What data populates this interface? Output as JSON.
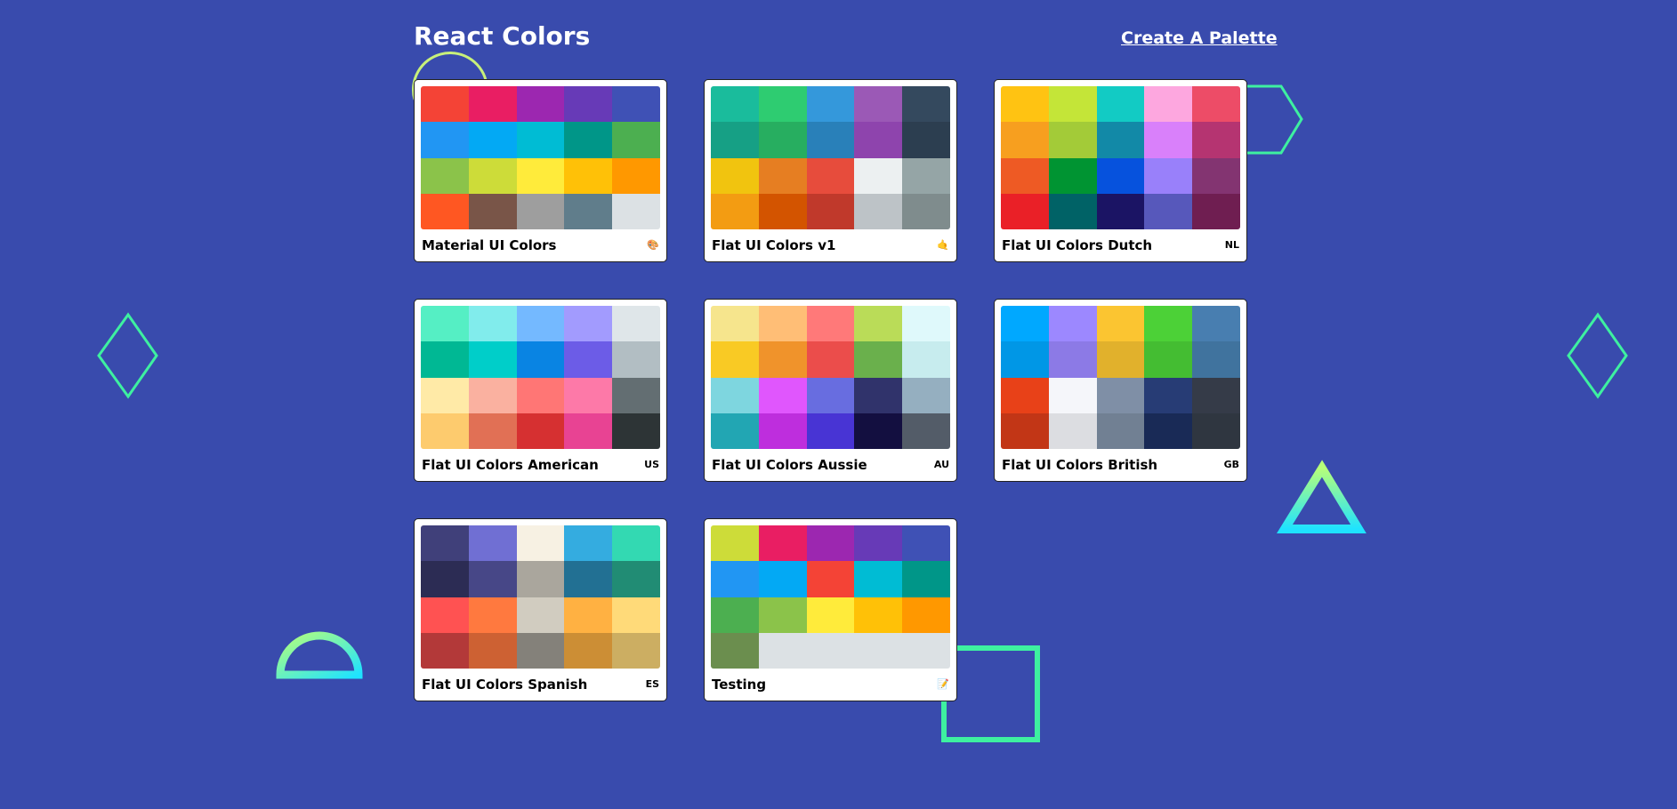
{
  "header": {
    "title": "React Colors",
    "create_link": "Create A Palette"
  },
  "palettes": [
    {
      "name": "Material UI Colors",
      "emoji": "🎨",
      "colors": [
        "#f44336",
        "#e91e63",
        "#9c27b0",
        "#673ab7",
        "#3f51b5",
        "#2196f3",
        "#03a9f4",
        "#00bcd4",
        "#009688",
        "#4caf50",
        "#8bc34a",
        "#cddc39",
        "#ffeb3b",
        "#ffc107",
        "#ff9800",
        "#ff5722",
        "#795548",
        "#9e9e9e",
        "#607d8b",
        "#dce1e4"
      ]
    },
    {
      "name": "Flat UI Colors v1",
      "emoji": "🤙",
      "colors": [
        "#1abc9c",
        "#2ecc71",
        "#3498db",
        "#9b59b6",
        "#34495e",
        "#16a085",
        "#27ae60",
        "#2980b9",
        "#8e44ad",
        "#2c3e50",
        "#f1c40f",
        "#e67e22",
        "#e74c3c",
        "#ecf0f1",
        "#95a5a6",
        "#f39c12",
        "#d35400",
        "#c0392b",
        "#bdc3c7",
        "#7f8c8d"
      ]
    },
    {
      "name": "Flat UI Colors Dutch",
      "emoji": "NL",
      "colors": [
        "#ffc312",
        "#c4e538",
        "#12cbc4",
        "#fda7df",
        "#ed4c67",
        "#f79f1f",
        "#a3cb38",
        "#1289a7",
        "#d980fa",
        "#b53471",
        "#ee5a24",
        "#009432",
        "#0652dd",
        "#9980fa",
        "#833471",
        "#ea2027",
        "#006266",
        "#1b1464",
        "#5758bb",
        "#6f1e51"
      ]
    },
    {
      "name": "Flat UI Colors American",
      "emoji": "US",
      "colors": [
        "#55efc4",
        "#81ecec",
        "#74b9ff",
        "#a29bfe",
        "#dfe6e9",
        "#00b894",
        "#00cec9",
        "#0984e3",
        "#6c5ce7",
        "#b2bec3",
        "#ffeaa7",
        "#fab1a0",
        "#ff7675",
        "#fd79a8",
        "#636e72",
        "#fdcb6e",
        "#e17055",
        "#d63031",
        "#e84393",
        "#2d3436"
      ]
    },
    {
      "name": "Flat UI Colors Aussie",
      "emoji": "AU",
      "colors": [
        "#f6e58d",
        "#ffbe76",
        "#ff7979",
        "#badc58",
        "#dff9fb",
        "#f9ca24",
        "#f0932b",
        "#eb4d4b",
        "#6ab04c",
        "#c7ecee",
        "#7ed6df",
        "#e056fd",
        "#686de0",
        "#30336b",
        "#95afc0",
        "#22a6b3",
        "#be2edd",
        "#4834d4",
        "#130f40",
        "#535c68"
      ]
    },
    {
      "name": "Flat UI Colors British",
      "emoji": "GB",
      "colors": [
        "#00a8ff",
        "#9c88ff",
        "#fbc531",
        "#4cd137",
        "#487eb0",
        "#0097e6",
        "#8c7ae6",
        "#e1b12c",
        "#44bd32",
        "#40739e",
        "#e84118",
        "#f5f6fa",
        "#7f8fa6",
        "#273c75",
        "#353b48",
        "#c23616",
        "#dcdde1",
        "#718093",
        "#192a56",
        "#2f3640"
      ]
    },
    {
      "name": "Flat UI Colors Spanish",
      "emoji": "ES",
      "colors": [
        "#40407a",
        "#706fd3",
        "#f7f1e3",
        "#34ace0",
        "#33d9b2",
        "#2c2c54",
        "#474787",
        "#aaa69d",
        "#227093",
        "#218c74",
        "#ff5252",
        "#ff793f",
        "#d1ccc0",
        "#ffb142",
        "#ffda79",
        "#b33939",
        "#cd6133",
        "#84817a",
        "#cc8e35",
        "#ccae62"
      ]
    },
    {
      "name": "Testing",
      "emoji": "📝",
      "colors": [
        "#cddc39",
        "#e91e63",
        "#9c27b0",
        "#673ab7",
        "#3f51b5",
        "#2196f3",
        "#03a9f4",
        "#f44336",
        "#00bcd4",
        "#009688",
        "#4caf50",
        "#8bc34a",
        "#ffeb3b",
        "#ffc107",
        "#ff9800",
        "#6b8e4e",
        "#dce1e4",
        "#dce1e4",
        "#dce1e4",
        "#dce1e4"
      ]
    }
  ],
  "decorations": {
    "stroke_color": "#3ef0a0",
    "gradient_colors": [
      "#b6ff7a",
      "#1fe3ff"
    ]
  }
}
